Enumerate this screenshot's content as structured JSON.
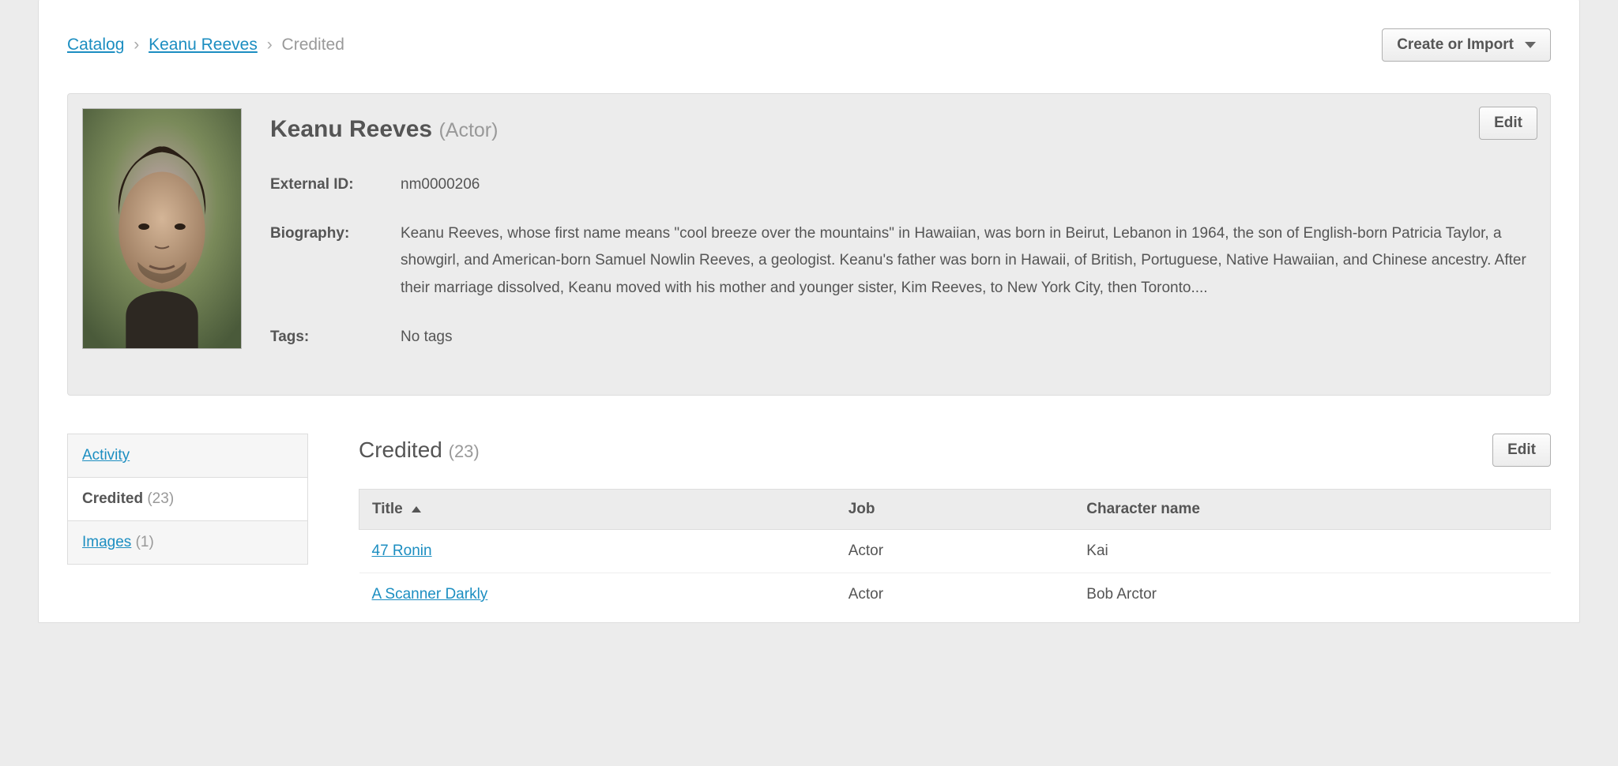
{
  "breadcrumb": {
    "items": [
      {
        "label": "Catalog",
        "link": true
      },
      {
        "label": "Keanu Reeves",
        "link": true
      },
      {
        "label": "Credited",
        "link": false
      }
    ]
  },
  "createButton": "Create or Import",
  "person": {
    "name": "Keanu Reeves",
    "role": "(Actor)",
    "editLabel": "Edit",
    "fields": {
      "externalId": {
        "label": "External ID:",
        "value": "nm0000206"
      },
      "biography": {
        "label": "Biography:",
        "value": "Keanu Reeves, whose first name means \"cool breeze over the mountains\" in Hawaiian, was born in Beirut, Lebanon in 1964, the son of English-born Patricia Taylor, a showgirl, and American-born Samuel Nowlin Reeves, a geologist. Keanu's father was born in Hawaii, of British, Portuguese, Native Hawaiian, and Chinese ancestry. After their marriage dissolved, Keanu moved with his mother and younger sister, Kim Reeves, to New York City, then Toronto...."
      },
      "tags": {
        "label": "Tags:",
        "value": "No tags"
      }
    }
  },
  "sideTabs": {
    "activity": {
      "label": "Activity"
    },
    "credited": {
      "label": "Credited",
      "count": "(23)"
    },
    "images": {
      "label": "Images",
      "count": "(1)"
    }
  },
  "creditedSection": {
    "title": "Credited",
    "count": "(23)",
    "editLabel": "Edit",
    "columns": {
      "title": "Title",
      "job": "Job",
      "character": "Character name"
    },
    "rows": [
      {
        "title": "47 Ronin",
        "job": "Actor",
        "character": "Kai"
      },
      {
        "title": "A Scanner Darkly",
        "job": "Actor",
        "character": "Bob Arctor"
      }
    ]
  }
}
